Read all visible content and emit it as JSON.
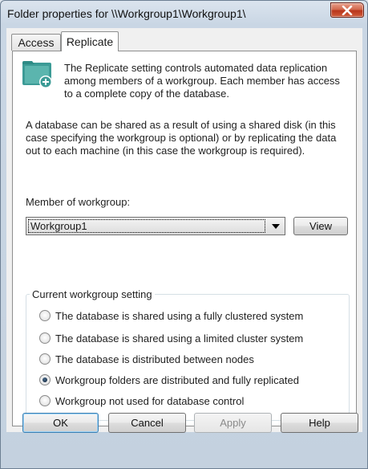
{
  "window": {
    "title": "Folder properties for \\\\Workgroup1\\Workgroup1\\"
  },
  "tabs": [
    {
      "label": "Access",
      "active": false
    },
    {
      "label": "Replicate",
      "active": true
    }
  ],
  "replicate": {
    "icon": "shared-folder-add-icon",
    "intro": "The Replicate setting controls automated data replication among members of a workgroup. Each member has access to a complete copy of the database.",
    "description": "A database can be shared as a result of using a shared disk (in this case specifying the workgroup is optional) or by replicating the data out to each machine (in this case the workgroup is required).",
    "member_label": "Member of workgroup:",
    "member_value": "Workgroup1",
    "view_label": "View",
    "group_caption": "Current workgroup setting",
    "options": [
      {
        "label": "The database is shared using a fully clustered system",
        "checked": false
      },
      {
        "label": "The database is shared using a limited cluster system",
        "checked": false
      },
      {
        "label": "The database is distributed between nodes",
        "checked": false
      },
      {
        "label": "Workgroup folders are distributed and fully replicated",
        "checked": true
      },
      {
        "label": "Workgroup not used for database control",
        "checked": false
      }
    ]
  },
  "footer": {
    "ok": "OK",
    "cancel": "Cancel",
    "apply": "Apply",
    "help": "Help"
  },
  "colors": {
    "icon_teal": "#2e8b8b",
    "close_red": "#c8452a"
  }
}
